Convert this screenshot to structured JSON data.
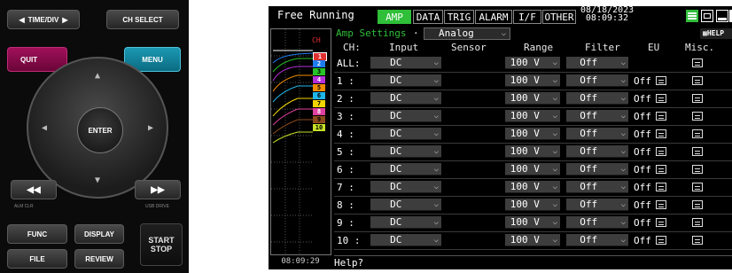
{
  "keypad": {
    "time_div": "TIME/DIV",
    "ch_select": "CH SELECT",
    "quit": "QUIT",
    "menu": "MENU",
    "enter": "ENTER",
    "alm_clr": "ALM CLR",
    "usb_drive": "USB DRIVE",
    "func": "FUNC",
    "display": "DISPLAY",
    "file": "FILE",
    "review": "REVIEW",
    "start": "START",
    "stop": "STOP",
    "rewind": "◀◀",
    "forward": "▶▶"
  },
  "screen": {
    "mode": "Free Running",
    "tabs": [
      "AMP",
      "DATA",
      "TRIG",
      "ALARM",
      "I/F",
      "OTHER"
    ],
    "active_tab": "AMP",
    "date": "08/18/2023",
    "time": "08:09:32",
    "clock": "08:09:29",
    "strip_title": "CH",
    "channel_tags": [
      "1",
      "2",
      "3",
      "4",
      "5",
      "6",
      "7",
      "8",
      "9",
      "10"
    ],
    "channel_colors": [
      "#ffffff",
      "#1e7cf0",
      "#27c227",
      "#b62fd8",
      "#f08c00",
      "#1fb6e8",
      "#f0d400",
      "#e040a0",
      "#8b4a1c",
      "#c8e028"
    ],
    "amp_settings_label": "Amp Settings",
    "amp_settings_value": "Analog",
    "help_badge": "HELP",
    "columns": {
      "ch": "CH:",
      "input": "Input",
      "sensor": "Sensor",
      "range": "Range",
      "filter": "Filter",
      "eu": "EU",
      "misc": "Misc."
    },
    "rows": [
      {
        "ch": "ALL:",
        "input": "DC",
        "range": "100 V",
        "filter": "Off",
        "eu": ""
      },
      {
        "ch": "1 :",
        "input": "DC",
        "range": "100 V",
        "filter": "Off",
        "eu": "Off"
      },
      {
        "ch": "2 :",
        "input": "DC",
        "range": "100 V",
        "filter": "Off",
        "eu": "Off"
      },
      {
        "ch": "3 :",
        "input": "DC",
        "range": "100 V",
        "filter": "Off",
        "eu": "Off"
      },
      {
        "ch": "4 :",
        "input": "DC",
        "range": "100 V",
        "filter": "Off",
        "eu": "Off"
      },
      {
        "ch": "5 :",
        "input": "DC",
        "range": "100 V",
        "filter": "Off",
        "eu": "Off"
      },
      {
        "ch": "6 :",
        "input": "DC",
        "range": "100 V",
        "filter": "Off",
        "eu": "Off"
      },
      {
        "ch": "7 :",
        "input": "DC",
        "range": "100 V",
        "filter": "Off",
        "eu": "Off"
      },
      {
        "ch": "8 :",
        "input": "DC",
        "range": "100 V",
        "filter": "Off",
        "eu": "Off"
      },
      {
        "ch": "9 :",
        "input": "DC",
        "range": "100 V",
        "filter": "Off",
        "eu": "Off"
      },
      {
        "ch": "10 :",
        "input": "DC",
        "range": "100 V",
        "filter": "Off",
        "eu": "Off"
      }
    ],
    "help_text": "Help?"
  }
}
